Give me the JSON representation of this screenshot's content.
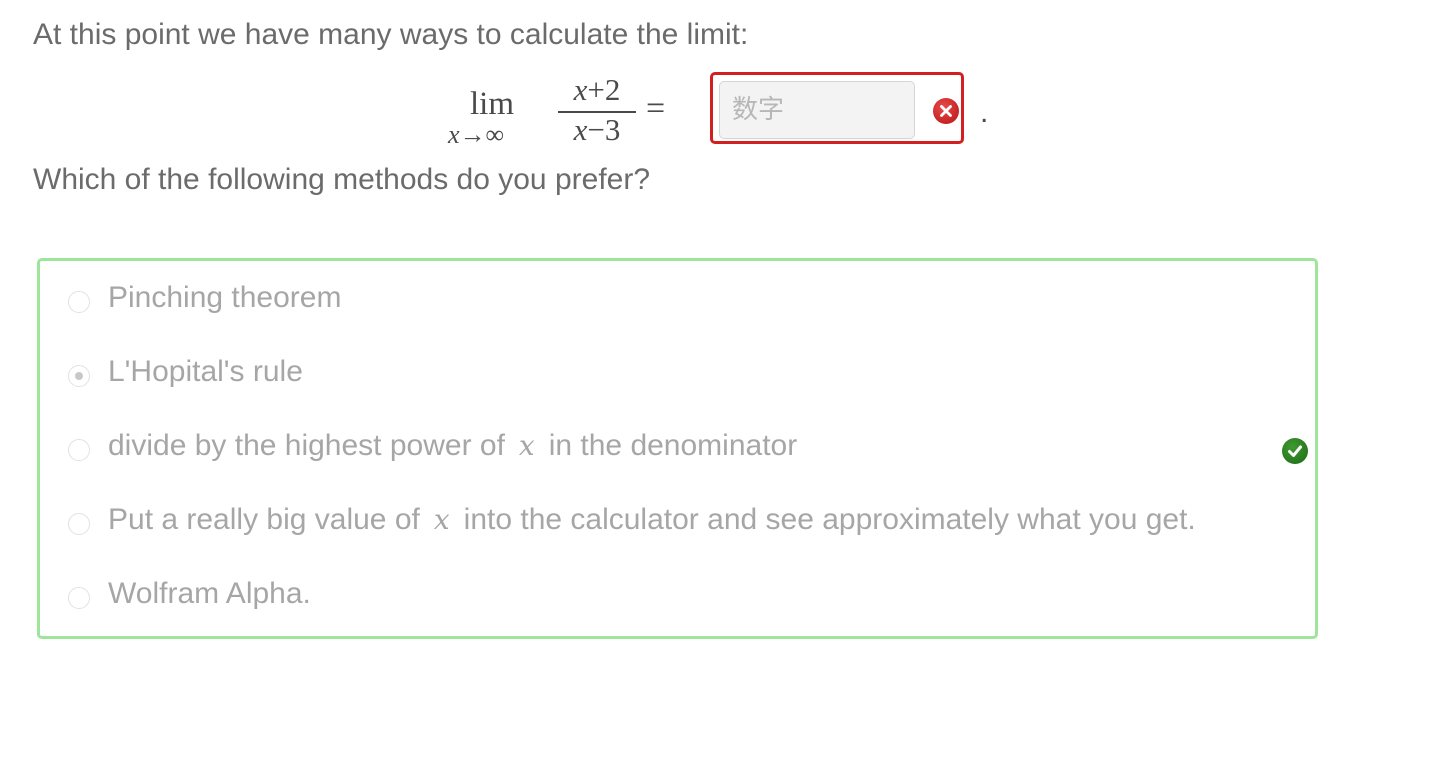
{
  "intro_text": "At this point we have many ways to calculate the limit:",
  "math": {
    "lim": "lim",
    "sub_var": "x",
    "sub_arrow": "→∞",
    "numerator_var": "x",
    "numerator_rest": "+2",
    "denominator_var": "x",
    "denominator_rest": "−3",
    "equals": "="
  },
  "answer": {
    "placeholder": "数字",
    "value": "",
    "status": "incorrect",
    "status_color": "#d21f1f",
    "status_icon": "error-x-icon"
  },
  "period": ".",
  "question_text": "Which of the following methods do you prefer?",
  "choices": {
    "border_color": "#9ee49a",
    "status_icon": "check-icon",
    "items": [
      {
        "label": "Pinching theorem",
        "selected": false
      },
      {
        "label": "L'Hopital's rule",
        "selected": true
      },
      {
        "label_before": "divide by the highest power of",
        "var": "x",
        "label_after": "in the denominator",
        "selected": false
      },
      {
        "label_before": "Put a really big value of",
        "var": "x",
        "label_after": "into the calculator and see approximately what you get.",
        "selected": false
      },
      {
        "label": "Wolfram Alpha.",
        "selected": false
      }
    ]
  }
}
